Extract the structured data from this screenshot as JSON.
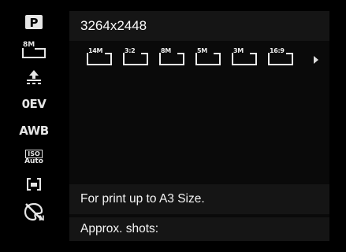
{
  "sidebar": {
    "items": [
      {
        "name": "P",
        "icon": "program-mode-icon"
      },
      {
        "name": "8M",
        "icon": "image-size-icon"
      },
      {
        "name": "",
        "icon": "quality-icon"
      },
      {
        "name": "0EV",
        "icon": "exposure-icon"
      },
      {
        "name": "AWB",
        "icon": "white-balance-icon"
      },
      {
        "name": "ISO",
        "sub": "Auto",
        "icon": "iso-icon"
      },
      {
        "name": "",
        "icon": "metering-icon"
      },
      {
        "name": "",
        "icon": "color-mode-icon"
      }
    ]
  },
  "resolution": "3264x2448",
  "size_options": [
    {
      "label": "14M"
    },
    {
      "label": "3:2"
    },
    {
      "label": "8M"
    },
    {
      "label": "5M"
    },
    {
      "label": "3M"
    },
    {
      "label": "16:9"
    }
  ],
  "description": "For print up to A3 Size.",
  "shots_label": "Approx. shots:",
  "colors": {
    "background": "#000000",
    "panel": "#151515",
    "text": "#ffffff"
  }
}
